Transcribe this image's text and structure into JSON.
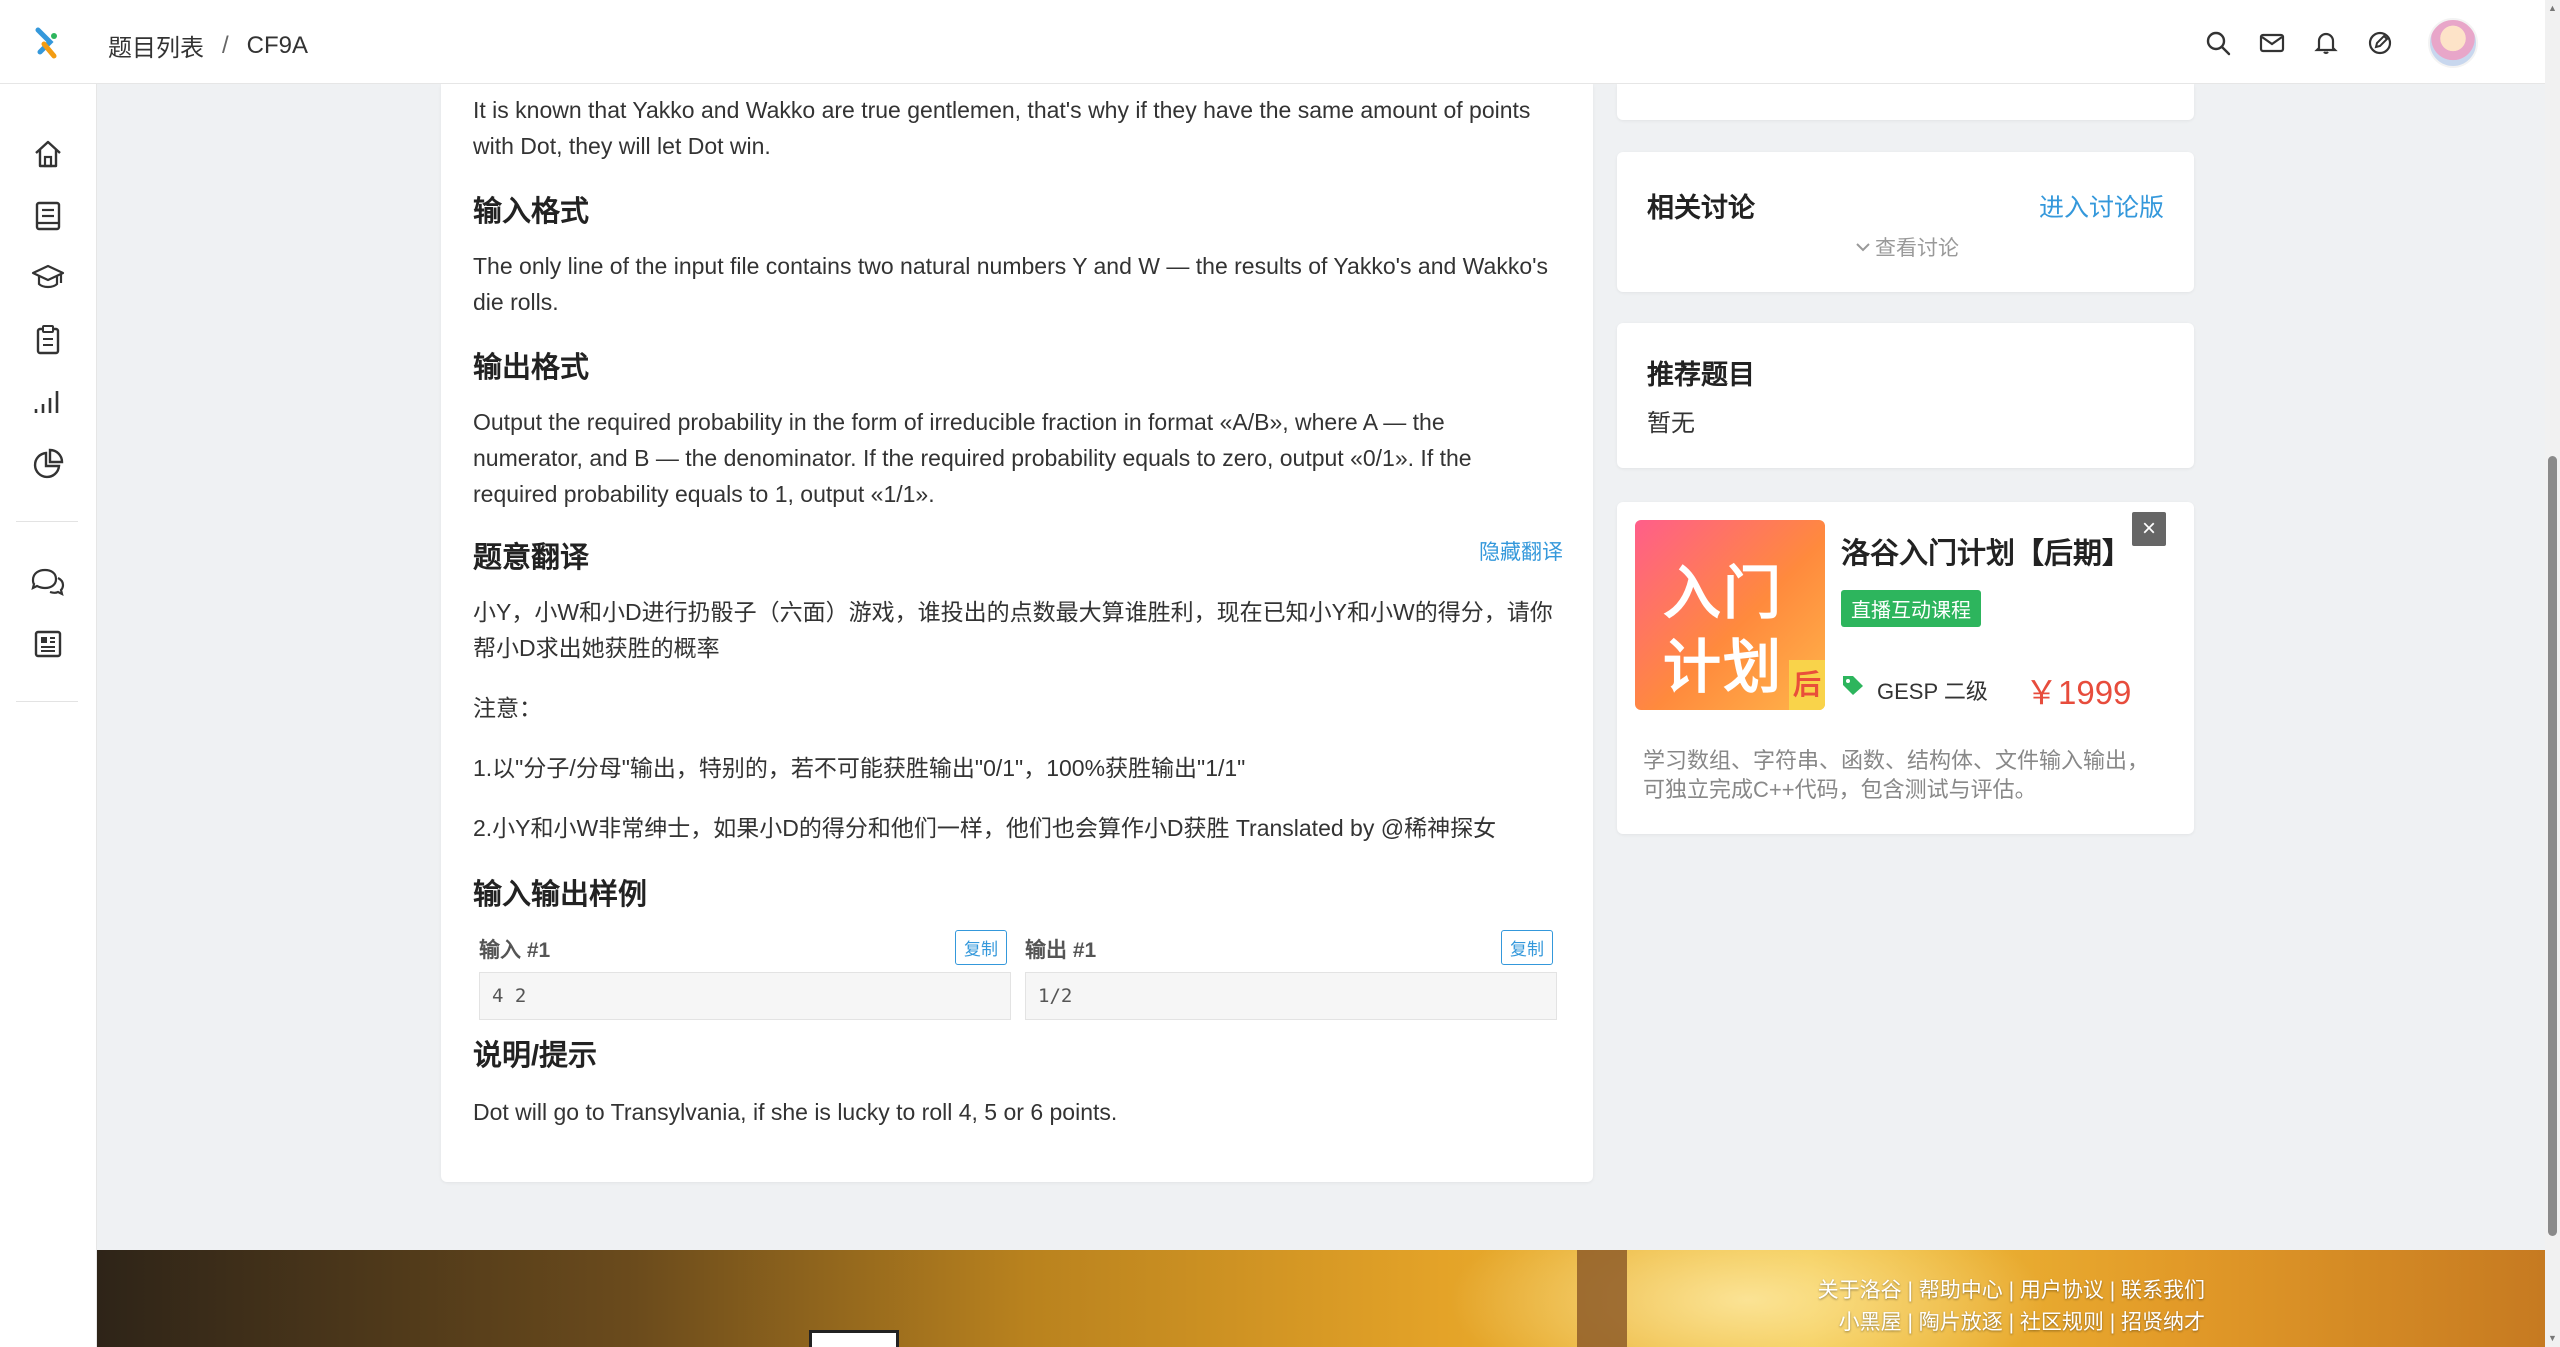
{
  "header": {
    "breadcrumb": [
      "题目列表",
      "/",
      "CF9A"
    ]
  },
  "sidebar": {
    "icons": [
      "home-icon",
      "book-icon",
      "graduation-cap-icon",
      "clipboard-icon",
      "signal-bars-icon",
      "pie-chart-icon",
      "chat-icon",
      "news-icon"
    ]
  },
  "problem": {
    "intro": "It is known that Yakko and Wakko are true gentlemen, that's why if they have the same amount of points with Dot, they will let Dot win.",
    "input_title": "输入格式",
    "input_text": "The only line of the input file contains two natural numbers Y and W — the results of Yakko's and Wakko's die rolls.",
    "output_title": "输出格式",
    "output_text": "Output the required probability in the form of irreducible fraction in format «A/B», where A — the numerator, and B — the denominator. If the required probability equals to zero, output «0/1». If the required probability equals to 1, output «1/1».",
    "translation_title": "题意翻译",
    "hide_translation": "隐藏翻译",
    "translation_p1": "小Y，小W和小D进行扔骰子（六面）游戏，谁投出的点数最大算谁胜利，现在已知小Y和小W的得分，请你帮小D求出她获胜的概率",
    "translation_note": "注意：",
    "translation_p2": "1.以\"分子/分母\"输出，特别的，若不可能获胜输出\"0/1\"，100%获胜输出\"1/1\"",
    "translation_p3": "2.小Y和小W非常绅士，如果小D的得分和他们一样，他们也会算作小D获胜 Translated by @稀神探女",
    "samples_title": "输入输出样例",
    "sample_input_label": "输入 #1",
    "sample_output_label": "输出 #1",
    "copy_label": "复制",
    "sample_input": "4 2",
    "sample_output": "1/2",
    "hint_title": "说明/提示",
    "hint_text": "Dot will go to Transylvania, if she is lucky to roll 4, 5 or 6 points."
  },
  "discussion": {
    "title": "相关讨论",
    "link": "进入讨论版",
    "view": "查看讨论"
  },
  "recommend": {
    "title": "推荐题目",
    "empty": "暂无"
  },
  "ad": {
    "image_line1": "入门",
    "image_line2": "计划",
    "image_tag": "后",
    "title": "洛谷入门计划【后期】",
    "badge": "直播互动课程",
    "level": "GESP 二级",
    "price": "￥1999",
    "close": "×",
    "desc": "学习数组、字符串、函数、结构体、文件输入输出，可独立完成C++代码，包含测试与评估。"
  },
  "footer": {
    "links_row1": "关于洛谷 | 帮助中心 | 用户协议 | 联系我们",
    "links_row2": "小黑屋 | 陶片放逐 | 社区规则 | 招贤纳才"
  },
  "colors": {
    "accent": "#3498db",
    "price": "#e74c3c",
    "badge": "#2db55d"
  }
}
